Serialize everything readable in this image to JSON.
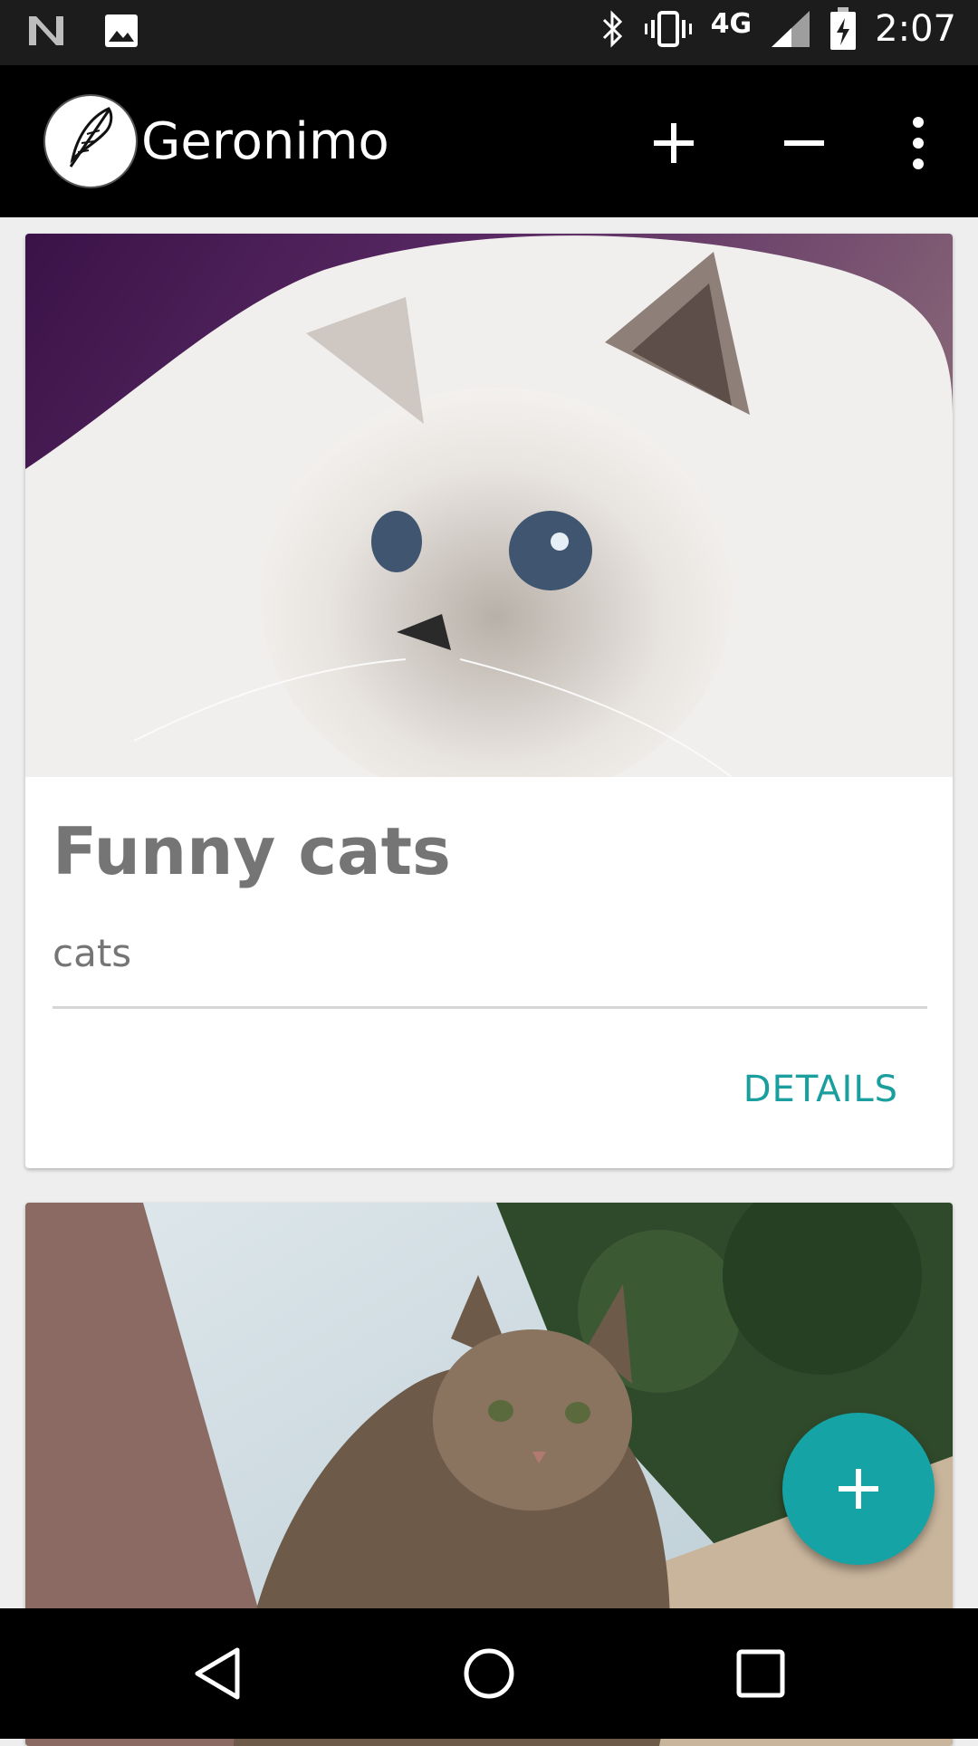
{
  "status_bar": {
    "time": "2:07",
    "network": "4G",
    "icons": [
      "notification-n-icon",
      "image-icon",
      "bluetooth-icon",
      "vibrate-icon",
      "signal-icon",
      "battery-charging-icon"
    ]
  },
  "app_bar": {
    "title": "Geronimo",
    "logo_icon": "feather-logo-icon",
    "actions": [
      "plus-icon",
      "minus-icon",
      "more-vert-icon"
    ]
  },
  "cards": [
    {
      "title": "Funny cats",
      "subtitle": "cats",
      "action_label": "DETAILS",
      "image": "white-cat-photo"
    },
    {
      "image": "tabby-cat-photo"
    }
  ],
  "fab": {
    "icon": "plus-icon"
  },
  "nav_bar": {
    "icons": [
      "back-icon",
      "home-icon",
      "recents-icon"
    ]
  },
  "colors": {
    "accent": "#16a3a5",
    "action_text": "#1a9e9e",
    "app_bar": "#000000",
    "background": "#eeeeee"
  }
}
